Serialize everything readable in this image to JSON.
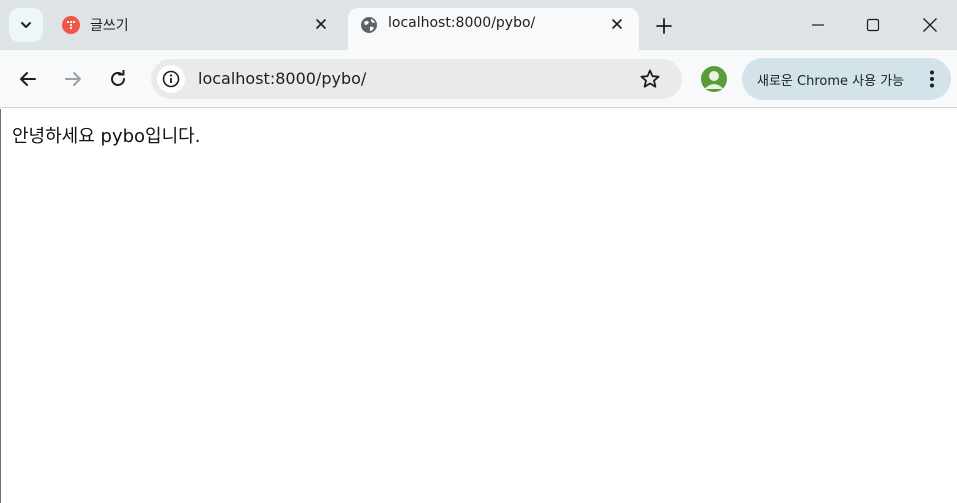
{
  "browser": {
    "tabs": [
      {
        "title": "글쓰기",
        "favicon": "tistory-icon",
        "active": false
      },
      {
        "title": "localhost:8000/pybo/",
        "favicon": "globe-icon",
        "active": true
      }
    ],
    "address_bar": {
      "url": "localhost:8000/pybo/"
    },
    "update_button": {
      "label": "새로운 Chrome 사용 가능"
    },
    "colors": {
      "tabstrip": "#dee3e6",
      "toolbar": "#f8f9fa",
      "omnibox": "#e8eaec",
      "update_pill": "#d3e3ea",
      "avatar": "#5a9b3c"
    }
  },
  "page": {
    "text": "안녕하세요 pybo입니다."
  }
}
